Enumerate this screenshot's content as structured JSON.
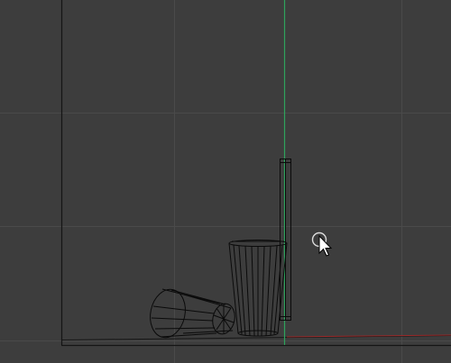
{
  "viewport": {
    "view_type": "3D wireframe viewport",
    "background_color": "#3d3d3d",
    "grid_color": "#4a4a4a",
    "frame_line_color": "#151515",
    "vertical_axis_color": "#2fa35c",
    "horizontal_axis_color": "#9a2a2a",
    "wire_color": "#0a0a0a",
    "cursor_icon": "rotate-cursor-icon"
  },
  "scene_objects": [
    {
      "name": "standing-cup",
      "kind": "tapered cylinder (cup)",
      "orientation": "upright"
    },
    {
      "name": "tipped-cup",
      "kind": "tapered cylinder (cup)",
      "orientation": "lying on side"
    },
    {
      "name": "thin-panel",
      "kind": "box",
      "orientation": "upright"
    }
  ]
}
